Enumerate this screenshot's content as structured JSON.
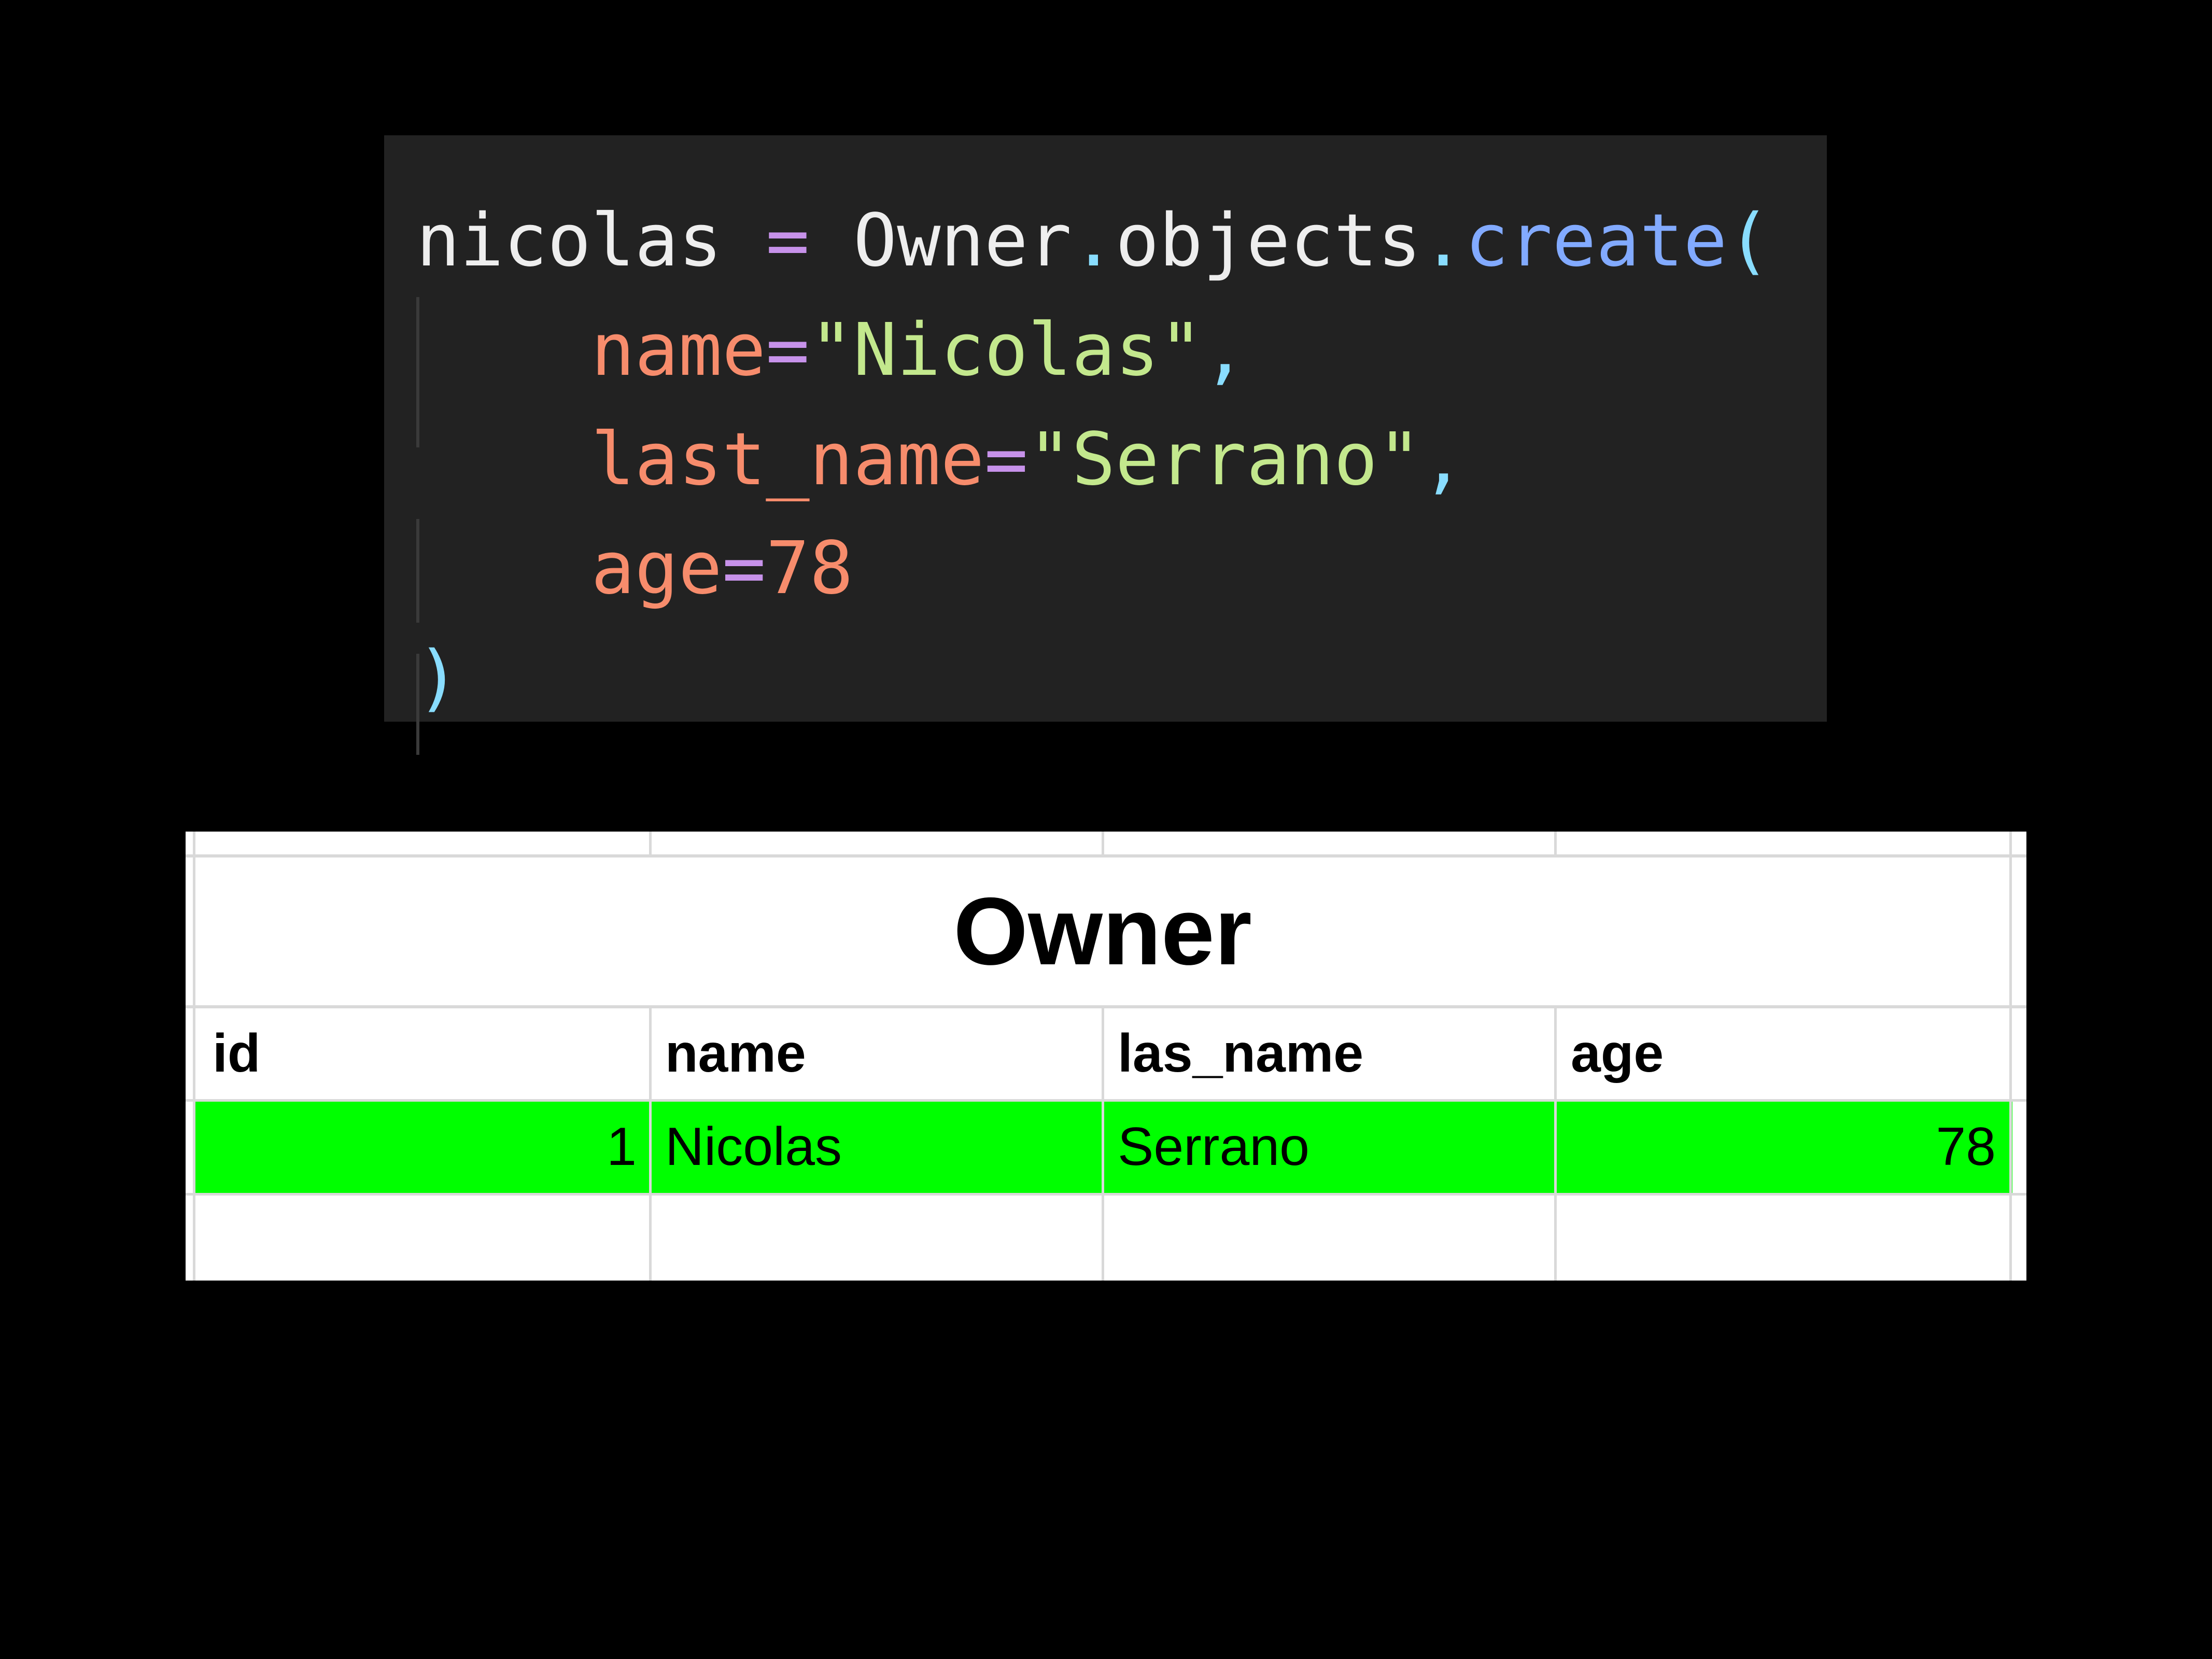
{
  "code": {
    "lines": [
      {
        "var": "nicolas",
        "assign": " = ",
        "cls": "Owner",
        "dot1": ".",
        "attr": "objects",
        "dot2": ".",
        "fn": "create",
        "open": "("
      },
      {
        "key": "name",
        "eq": "=",
        "val": "\"Nicolas\"",
        "comma": ","
      },
      {
        "key": "last_name",
        "eq": "=",
        "val": "\"Serrano\"",
        "comma": ","
      },
      {
        "key": "age",
        "eq": "=",
        "val": "78"
      },
      {
        "close": ")"
      }
    ]
  },
  "sheet": {
    "title": "Owner",
    "columns": [
      "id",
      "name",
      "las_name",
      "age"
    ],
    "rows": [
      [
        "1",
        "Nicolas",
        "Serrano",
        "78"
      ]
    ],
    "row_highlight_color": "#00ff00"
  }
}
